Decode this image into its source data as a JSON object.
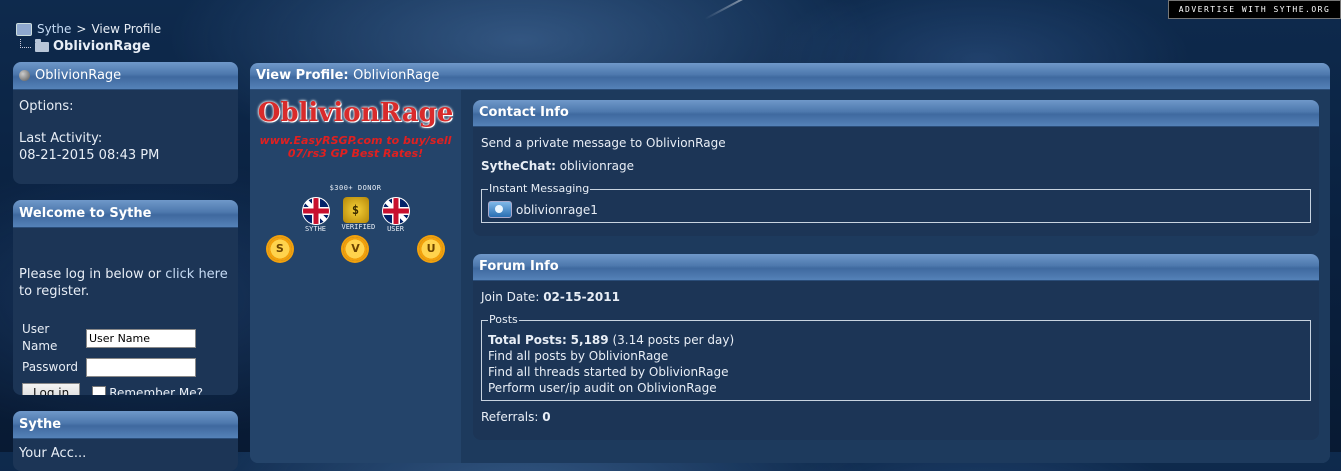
{
  "advert": "ADVERTISE WITH SYTHE.ORG",
  "breadcrumb": {
    "root": "Sythe",
    "sep": ">",
    "current_page": "View Profile",
    "title": "OblivionRage"
  },
  "left": {
    "status": {
      "title": "OblivionRage",
      "options_label": "Options:",
      "last_activity_label": "Last Activity:",
      "last_activity_value": "08-21-2015 08:43 PM"
    },
    "welcome": {
      "title": "Welcome to Sythe",
      "text_pre": "Please log in below or ",
      "link_text": "click here",
      "text_post": " to register.",
      "username_label": "User Name",
      "username_value": "User Name",
      "password_label": "Password",
      "login_button": "Log in",
      "remember_label": "Remember Me?"
    },
    "sythe": {
      "title": "Sythe",
      "partial_text": "Your Acc..."
    }
  },
  "main": {
    "header_label": "View Profile:",
    "header_name": "OblivionRage",
    "profile": {
      "logo_text": "OblivionRage",
      "tagline_line1": "www.EasyRSGP.com to buy/sell",
      "tagline_line2": "07/rs3 GP Best Rates!",
      "donor_text": "$300+ DONOR",
      "badges": [
        "SYTHE",
        "VERIFIED",
        "USER"
      ],
      "rank_letters": [
        "S",
        "V",
        "U"
      ]
    },
    "contact": {
      "title": "Contact Info",
      "pm_text": "Send a private message to OblivionRage",
      "sythechat_label": "SytheChat:",
      "sythechat_value": "oblivionrage",
      "im_legend": "Instant Messaging",
      "im_value": "oblivionrage1"
    },
    "forum": {
      "title": "Forum Info",
      "join_label": "Join Date:",
      "join_value": "02-15-2011",
      "posts_legend": "Posts",
      "total_label": "Total Posts:",
      "total_value": "5,189",
      "per_day": "(3.14 posts per day)",
      "find_posts": "Find all posts by OblivionRage",
      "find_threads": "Find all threads started by OblivionRage",
      "audit": "Perform user/ip audit on OblivionRage",
      "referrals_label": "Referrals:",
      "referrals_value": "0"
    }
  }
}
